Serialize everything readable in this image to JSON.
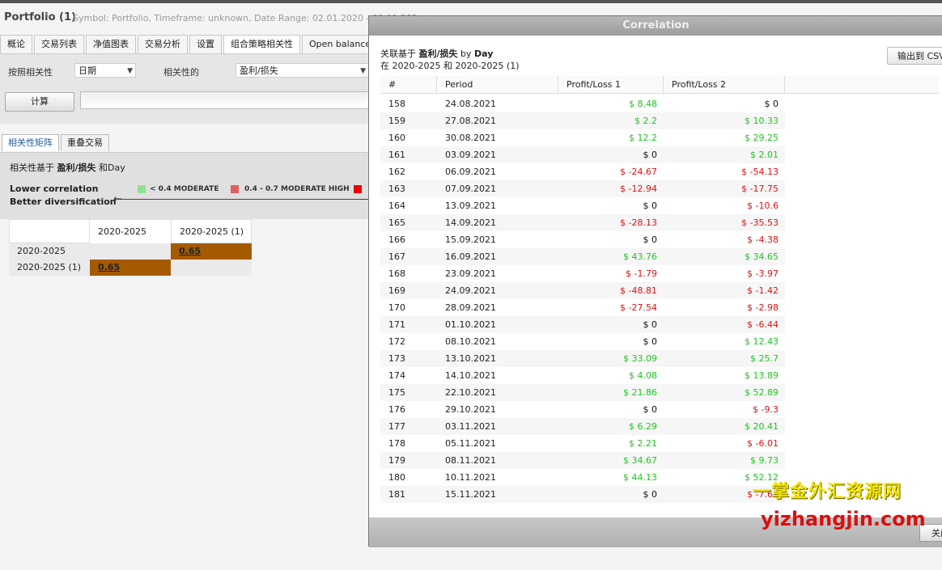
{
  "app": {
    "title": "Portfolio (1)",
    "meta": "Symbol: Portfolio, Timeframe: unknown, Date Range: 02.01.2020 - 09.01.202"
  },
  "tabs": [
    "概论",
    "交易列表",
    "净值图表",
    "交易分析",
    "设置",
    "组合策略相关性",
    "Open balances"
  ],
  "controls": {
    "by_label": "按照相关性",
    "by_value": "日期",
    "of_label": "相关性的",
    "of_value": "盈利/损失",
    "calc_button": "计算"
  },
  "subtabs": [
    "相关性矩阵",
    "重叠交易"
  ],
  "legend": {
    "title_prefix": "相关性基于",
    "title_metric": "盈利/损失",
    "title_suffix": "和Day",
    "lower_line1": "Lower correlation",
    "lower_line2": "Better diversification",
    "items": [
      {
        "label": "< 0.4 MODERATE",
        "color": "#90e090"
      },
      {
        "label": "0.4 - 0.7 MODERATE HIGH",
        "color": "#e06060"
      },
      {
        "label": "",
        "color": "#ee0000"
      }
    ]
  },
  "matrix": {
    "columns": [
      "2020-2025",
      "2020-2025 (1)"
    ],
    "rows": [
      {
        "label": "2020-2025",
        "cells": [
          "",
          "0.65"
        ]
      },
      {
        "label": "2020-2025 (1)",
        "cells": [
          "0.65",
          ""
        ]
      }
    ],
    "highlight_color": "#a65a00"
  },
  "dialog": {
    "title": "Correlation",
    "line1_prefix": "关联基于",
    "line1_metric": "盈利/损失",
    "line1_mid": "by",
    "line1_unit": "Day",
    "line2": "在 2020-2025 和 2020-2025 (1)",
    "export_button": "输出到 CSV",
    "close_button": "关闭",
    "columns": [
      "#",
      "Period",
      "Profit/Loss 1",
      "Profit/Loss 2"
    ],
    "rows": [
      {
        "n": "158",
        "period": "24.08.2021",
        "p1": "$ 8.48",
        "p2": "$ 0"
      },
      {
        "n": "159",
        "period": "27.08.2021",
        "p1": "$ 2.2",
        "p2": "$ 10.33"
      },
      {
        "n": "160",
        "period": "30.08.2021",
        "p1": "$ 12.2",
        "p2": "$ 29.25"
      },
      {
        "n": "161",
        "period": "03.09.2021",
        "p1": "$ 0",
        "p2": "$ 2.01"
      },
      {
        "n": "162",
        "period": "06.09.2021",
        "p1": "$ -24.67",
        "p2": "$ -54.13"
      },
      {
        "n": "163",
        "period": "07.09.2021",
        "p1": "$ -12.94",
        "p2": "$ -17.75"
      },
      {
        "n": "164",
        "period": "13.09.2021",
        "p1": "$ 0",
        "p2": "$ -10.6"
      },
      {
        "n": "165",
        "period": "14.09.2021",
        "p1": "$ -28.13",
        "p2": "$ -35.53"
      },
      {
        "n": "166",
        "period": "15.09.2021",
        "p1": "$ 0",
        "p2": "$ -4.38"
      },
      {
        "n": "167",
        "period": "16.09.2021",
        "p1": "$ 43.76",
        "p2": "$ 34.65"
      },
      {
        "n": "168",
        "period": "23.09.2021",
        "p1": "$ -1.79",
        "p2": "$ -3.97"
      },
      {
        "n": "169",
        "period": "24.09.2021",
        "p1": "$ -48.81",
        "p2": "$ -1.42"
      },
      {
        "n": "170",
        "period": "28.09.2021",
        "p1": "$ -27.54",
        "p2": "$ -2.98"
      },
      {
        "n": "171",
        "period": "01.10.2021",
        "p1": "$ 0",
        "p2": "$ -6.44"
      },
      {
        "n": "172",
        "period": "08.10.2021",
        "p1": "$ 0",
        "p2": "$ 12.43"
      },
      {
        "n": "173",
        "period": "13.10.2021",
        "p1": "$ 33.09",
        "p2": "$ 25.7"
      },
      {
        "n": "174",
        "period": "14.10.2021",
        "p1": "$ 4.08",
        "p2": "$ 13.89"
      },
      {
        "n": "175",
        "period": "22.10.2021",
        "p1": "$ 21.86",
        "p2": "$ 52.89"
      },
      {
        "n": "176",
        "period": "29.10.2021",
        "p1": "$ 0",
        "p2": "$ -9.3"
      },
      {
        "n": "177",
        "period": "03.11.2021",
        "p1": "$ 6.29",
        "p2": "$ 20.41"
      },
      {
        "n": "178",
        "period": "05.11.2021",
        "p1": "$ 2.21",
        "p2": "$ -6.01"
      },
      {
        "n": "179",
        "period": "08.11.2021",
        "p1": "$ 34.67",
        "p2": "$ 9.73"
      },
      {
        "n": "180",
        "period": "10.11.2021",
        "p1": "$ 44.13",
        "p2": "$ 52.12"
      },
      {
        "n": "181",
        "period": "15.11.2021",
        "p1": "$ 0",
        "p2": "$ -7.61"
      }
    ]
  },
  "watermark": {
    "line1": "一掌金外汇资源网",
    "line2": "yizhangjin.com"
  }
}
